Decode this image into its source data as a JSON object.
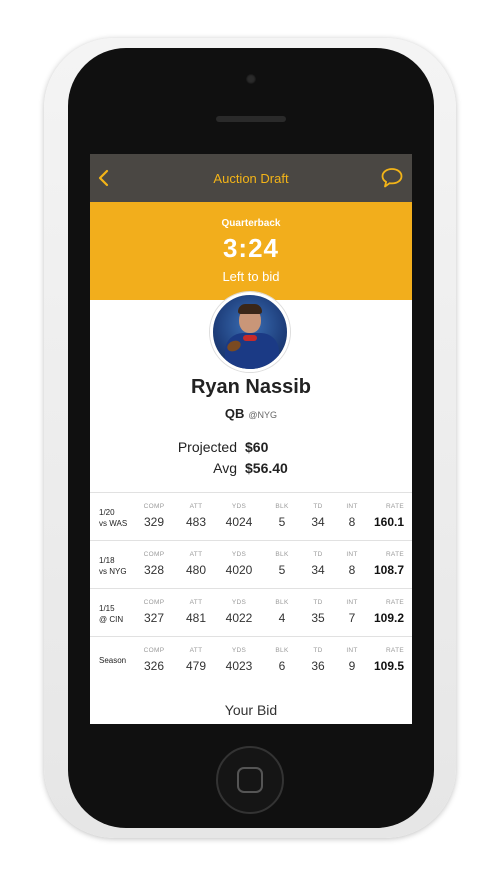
{
  "nav": {
    "title": "Auction Draft",
    "back_icon": "chevron-left-icon",
    "chat_icon": "chat-bubble-icon",
    "accent": "#f3b418",
    "bar_color": "#4a4743"
  },
  "banner": {
    "position": "Quarterback",
    "timer": "3:24",
    "subtitle": "Left to bid",
    "color": "#f2ae1c"
  },
  "player": {
    "name": "Ryan Nassib",
    "position": "QB",
    "team": "@NYG"
  },
  "valuation": {
    "projected_label": "Projected",
    "projected_value": "$60",
    "avg_label": "Avg",
    "avg_value": "$56.40"
  },
  "stats": {
    "headers": [
      "COMP",
      "ATT",
      "YDS",
      "BLK",
      "TD",
      "INT",
      "RATE"
    ],
    "rows": [
      {
        "label_line1": "1/20",
        "label_line2": "vs WAS",
        "values": [
          "329",
          "483",
          "4024",
          "5",
          "34",
          "8",
          "160.1"
        ]
      },
      {
        "label_line1": "1/18",
        "label_line2": "vs NYG",
        "values": [
          "328",
          "480",
          "4020",
          "5",
          "34",
          "8",
          "108.7"
        ]
      },
      {
        "label_line1": "1/15",
        "label_line2": "@ CIN",
        "values": [
          "327",
          "481",
          "4022",
          "4",
          "35",
          "7",
          "109.2"
        ]
      },
      {
        "label_line1": "Season",
        "label_line2": "",
        "values": [
          "326",
          "479",
          "4023",
          "6",
          "36",
          "9",
          "109.5"
        ]
      }
    ]
  },
  "bid": {
    "label": "Your Bid"
  }
}
